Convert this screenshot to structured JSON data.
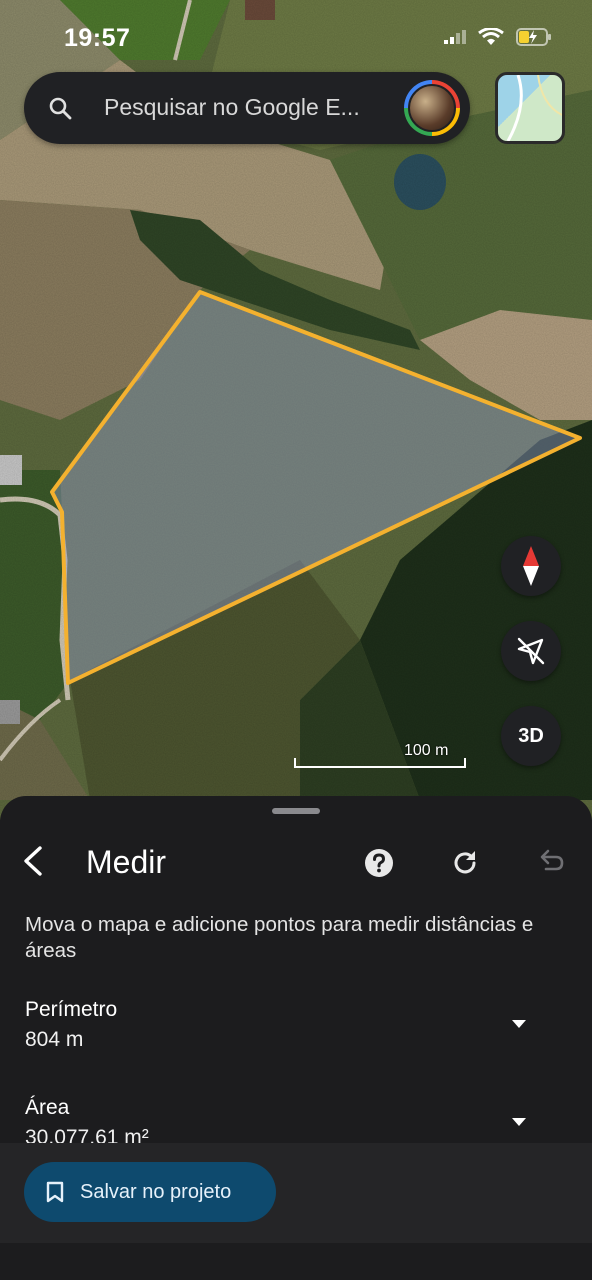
{
  "status_bar": {
    "time": "19:57"
  },
  "search": {
    "placeholder": "Pesquisar no Google E..."
  },
  "map": {
    "scale_label": "100 m",
    "compass_colors": {
      "north": "#e53935",
      "south": "#ffffff"
    },
    "polygon_color": "#f4b12f",
    "fab_3d_label": "3D"
  },
  "panel": {
    "title": "Medir",
    "description": "Mova o mapa e adicione pontos para medir distâncias e áreas",
    "perimeter": {
      "label": "Perímetro",
      "value": "804 m"
    },
    "area": {
      "label": "Área",
      "value": "30.077,61 m²"
    },
    "save_button_label": "Salvar no projeto",
    "accent_color": "#0e4a6e"
  }
}
